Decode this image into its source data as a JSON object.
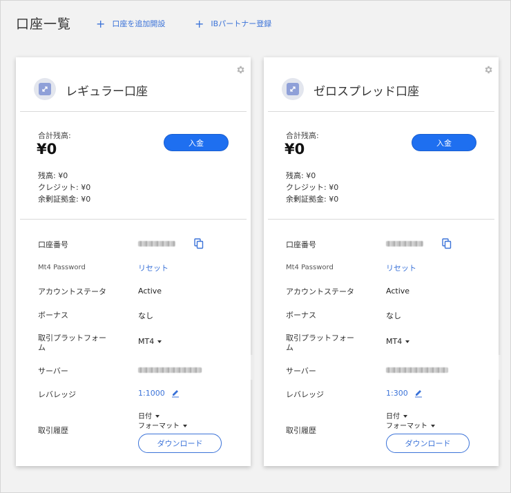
{
  "header": {
    "title": "口座一覧",
    "links": [
      {
        "label": "口座を追加開設",
        "icon": "plus-icon"
      },
      {
        "label": "IBパートナー登録",
        "icon": "plus-icon"
      }
    ]
  },
  "labels": {
    "total_balance": "合計残高:",
    "deposit": "入金",
    "account_number": "口座番号",
    "mt4_password": "Mt4 Password",
    "account_status": "アカウントステータ",
    "bonus": "ボーナス",
    "platform_line1": "取引プラットフォー",
    "platform_line2": "ム",
    "server": "サーバー",
    "leverage": "レバレッジ",
    "history": "取引履歴",
    "date": "日付",
    "format": "フォーマット",
    "download": "ダウンロード",
    "reset": "リセット"
  },
  "accounts": [
    {
      "name": "レギュラー口座",
      "total_balance": "¥0",
      "balance": "残高: ¥0",
      "credit": "クレジット: ¥0",
      "free_margin": "余剰証拠金: ¥0",
      "status": "Active",
      "bonus": "なし",
      "platform": "MT4",
      "leverage": "1:1000"
    },
    {
      "name": "ゼロスプレッド口座",
      "total_balance": "¥0",
      "balance": "残高: ¥0",
      "credit": "クレジット: ¥0",
      "free_margin": "余剰証拠金: ¥0",
      "status": "Active",
      "bonus": "なし",
      "platform": "MT4",
      "leverage": "1:300"
    }
  ],
  "colors": {
    "accent": "#1e6ff0",
    "link": "#3a72d8"
  }
}
